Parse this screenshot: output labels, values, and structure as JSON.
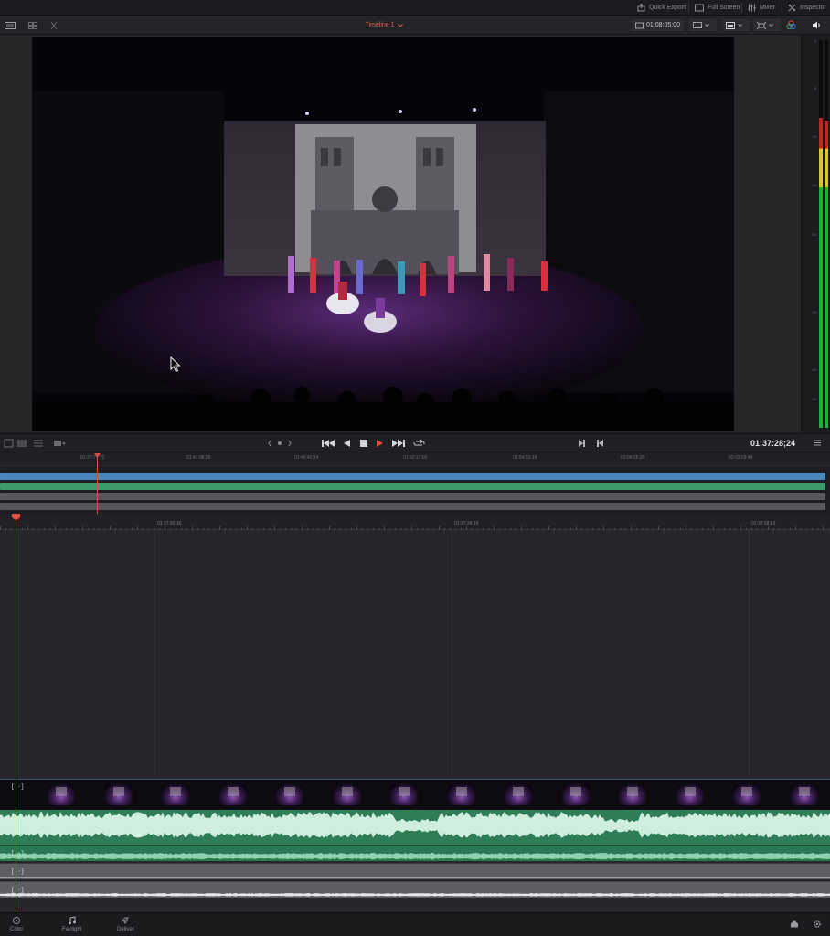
{
  "topbar": {
    "quick_export": "Quick Export",
    "full_screen": "Full Screen",
    "mixer": "Mixer",
    "inspector": "Inspector"
  },
  "viewer_toolbar": {
    "timeline_name": "Timeline 1",
    "timecode": "01:08:05:00"
  },
  "transport": {
    "current_timecode": "01:37:28;24"
  },
  "overview_ruler": {
    "ticks": [
      "01:2?:??;?2",
      "01:41:08;26",
      "01:46:42;14",
      "01:52:17;02",
      "01:54:51;16",
      "01:04:25;20",
      "02:02:59;48"
    ]
  },
  "timeline_ruler": {
    "ticks": [
      "01:37:20;16",
      "01:37:24;16",
      "01:37:28;16"
    ]
  },
  "meter": {
    "scale": [
      "0",
      "-5",
      "-10",
      "-15",
      "-20",
      "-30",
      "-40",
      "-50"
    ],
    "level_green": 0.62,
    "level_yellow": 0.1,
    "level_red": 0.08
  },
  "tracks": {
    "video_tag": "[··]",
    "audio_tags": [
      "[··]",
      "[··]",
      "[··]"
    ]
  },
  "pages": {
    "color": "Color",
    "fairlight": "Fairlight",
    "deliver": "Deliver"
  },
  "colors": {
    "accent_red": "#e64b3c",
    "track_blue": "#4b86b8",
    "track_green": "#3c9a6a",
    "audio_green": "#2e7d57"
  }
}
